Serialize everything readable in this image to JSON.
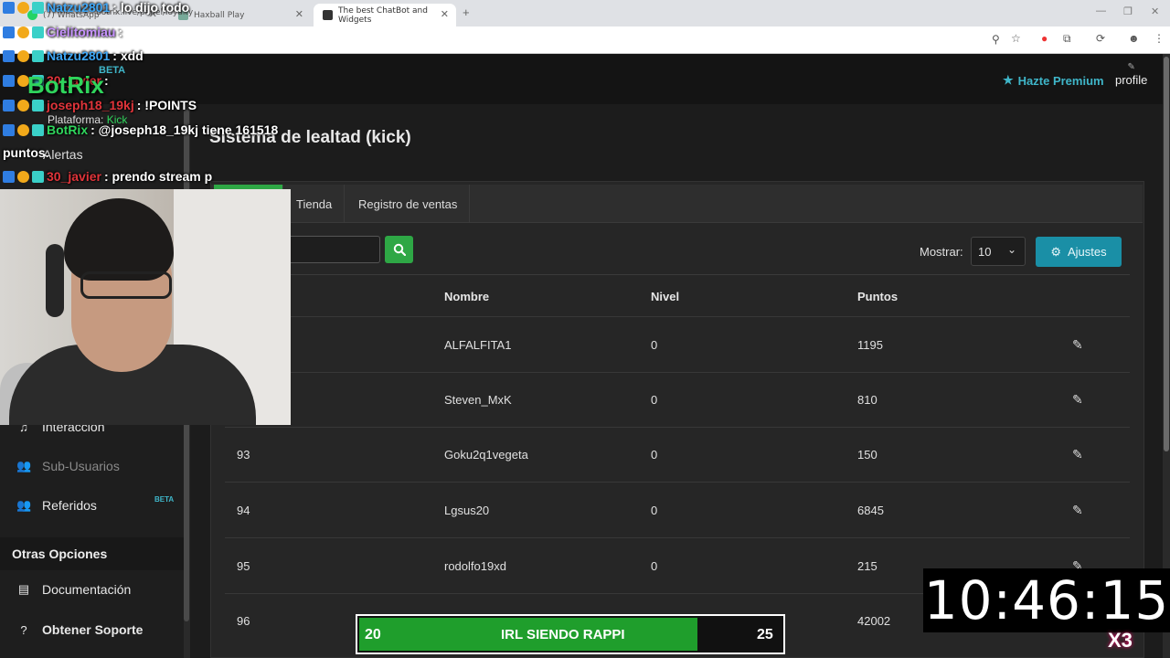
{
  "browser": {
    "tabs": [
      {
        "title": "(7) WhatsApp"
      },
      {
        "title": "Haxball Play"
      },
      {
        "title": "The best ChatBot and Widgets",
        "active": true
      }
    ],
    "url": "botrix.live/panel/loyalty"
  },
  "header": {
    "premium_label": "Hazte Premium",
    "profile_label": "profile"
  },
  "sidebar": {
    "items": [
      {
        "label": "Interacción",
        "icon": "music-icon"
      },
      {
        "label": "Sub-Usuarios",
        "icon": "users-icon",
        "disabled": true
      },
      {
        "label": "Referidos",
        "icon": "users-icon",
        "badge": "BETA"
      }
    ],
    "section_title": "Otras Opciones",
    "other": [
      {
        "label": "Documentación",
        "icon": "document-icon"
      },
      {
        "label": "Obtener Soporte",
        "icon": "help-icon"
      }
    ]
  },
  "page": {
    "title": "Sistema de lealtad (kick)",
    "tabs": [
      {
        "label": "Tienda"
      },
      {
        "label": "Registro de ventas"
      }
    ],
    "mostrar_label": "Mostrar:",
    "mostrar_value": "10",
    "ajustes_label": "Ajustes"
  },
  "table": {
    "columns": [
      "Nombre",
      "Nivel",
      "Puntos"
    ],
    "rows": [
      {
        "id": "",
        "nombre": "ALFALFITA1",
        "nivel": "0",
        "puntos": "1195"
      },
      {
        "id": "",
        "nombre": "Steven_MxK",
        "nivel": "0",
        "puntos": "810"
      },
      {
        "id": "93",
        "nombre": "Goku2q1vegeta",
        "nivel": "0",
        "puntos": "150"
      },
      {
        "id": "94",
        "nombre": "Lgsus20",
        "nivel": "0",
        "puntos": "6845"
      },
      {
        "id": "95",
        "nombre": "rodolfo19xd",
        "nivel": "0",
        "puntos": "215"
      },
      {
        "id": "96",
        "nombre": "",
        "nivel": "",
        "puntos": "42002"
      }
    ]
  },
  "overlay": {
    "chat": [
      {
        "user": "Natzu2801",
        "user_color": "#3fa7f5",
        "msg": ": lo dijo todo"
      },
      {
        "user": "Cielitomiau",
        "user_color": "#c792ff",
        "msg": ":"
      },
      {
        "user": "Natzu2801",
        "user_color": "#3fa7f5",
        "msg": ": xdd"
      },
      {
        "user": "30_javier",
        "user_color": "#e0343a",
        "msg": ":"
      },
      {
        "user": "joseph18_19kj",
        "user_color": "#e0343a",
        "msg": ": !POINTS"
      },
      {
        "user": "BotRix",
        "user_color": "#2fd55c",
        "msg": ": @joseph18_19kj tiene 161518"
      },
      {
        "user": "",
        "user_color": "#fff",
        "msg": "puntos."
      },
      {
        "user": "30_javier",
        "user_color": "#e0343a",
        "msg": ": prendo stream p"
      }
    ],
    "logo_text": "BotRix",
    "logo_beta": "BETA",
    "plataforma_label": "Plataforma:",
    "plataforma_value": "Kick",
    "alertas_label": "Alertas",
    "clock": "10:46:15",
    "goal": {
      "start": "20",
      "label": "IRL SIENDO RAPPI",
      "end": "25",
      "progress": 0.8
    },
    "multiplier": "X3"
  },
  "colors": {
    "accent_green": "#2ea745",
    "accent_teal": "#1a8fa6",
    "premium_teal": "#3fb6c9"
  }
}
